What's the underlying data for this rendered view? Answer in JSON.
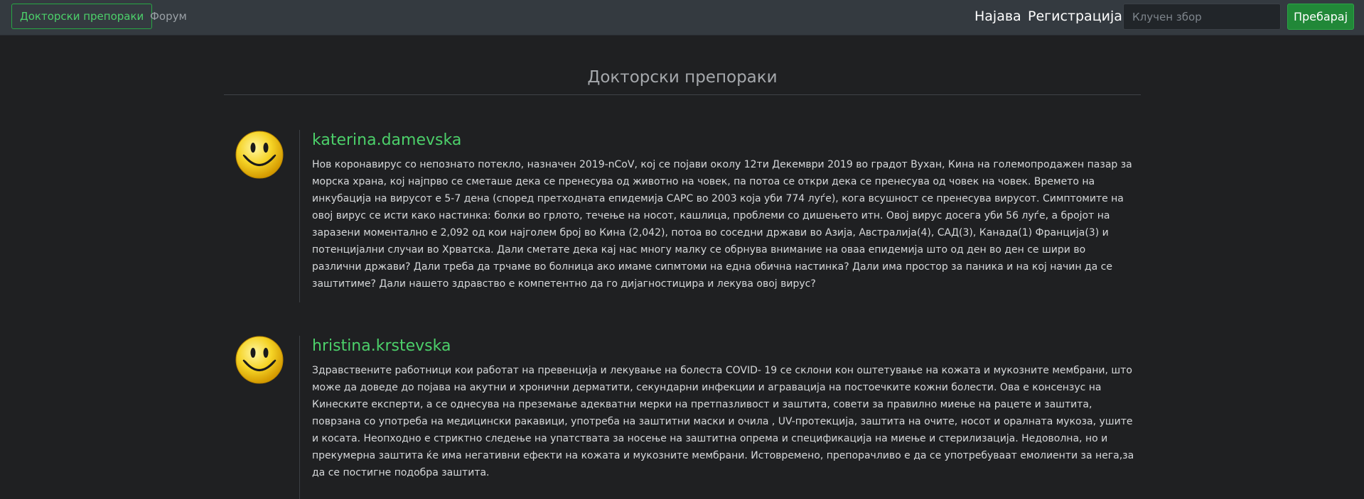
{
  "navbar": {
    "brand_label": "Докторски препораки",
    "forum_label": "Форум",
    "login_label": "Најава",
    "register_label": "Регистрација",
    "search_placeholder": "Клучен збор",
    "search_button_label": "Пребарај",
    "accent_color": "#28a745"
  },
  "main": {
    "title": "Докторски препораки",
    "posts": [
      {
        "avatar_icon": "smiley-face-icon",
        "username": "katerina.damevska",
        "text": "Нов коронавирус со непознато потекло, назначен 2019-nCoV, кој се појави околу 12ти Декември 2019 во градот Вухан, Кина на големопродажен пазар за морска храна, кој најпрво се сметаше дека се пренесува од животно на човек, па потоа се откри дека се пренесува од човек на човек. Времето на инкубација на вирусот е 5-7 дена (според претходната епидемија САРС во 2003 која уби 774 луѓе), кога всушност се пренесува вирусот. Симптомите на овој вирус се исти како настинка: болки во грлото, течење на носот, кашлица, проблеми со дишењето итн. Овој вирус досега уби 56 луѓе, а бројот на заразени моментално е 2,092 од кои најголем број во Кина (2,042), потоа во соседни држави во Азија, Австралија(4), САД(3), Канада(1) Франција(3) и потенцијални случаи во Хрватска. Дали сметате дека кај нас многу малку се обрнува внимание на оваа епидемија што од ден во ден се шири во различни држави? Дали треба да трчаме во болница ако имаме сипмтоми на една обична настинка? Дали има простор за паника и на кој начин да се заштитиме? Дали нашето здравство е компетентно да го дијагностицира и лекува овој вирус?"
      },
      {
        "avatar_icon": "smiley-face-icon",
        "username": "hristina.krstevska",
        "text": "Здравствените работници кои работат на превенција и лекување на болеста COVID- 19 се склони кон оштетување на кожата и мукозните мембрани, што може да доведе до појава на акутни и хронични дерматити, секундарни инфекции и агравација на постоечките кожни болести. Ова е консензус на Кинеските експерти, а се однесува на преземање адекватни мерки на претпазливост и заштита, совети за правилно миење на рацете и заштита, поврзана со употреба на медицински ракавици, употреба на заштитни маски и очила , UV-протекција, заштита на очите, носот и оралната мукоза, ушите и косата. Неопходно е стриктно следење на упатствата за носење на заштитна опрема и спецификација на миење и стерилизација. Недоволна, но и прекумерна заштита ќе има негативни ефекти на кожата и мукозните мембрани. Истовремено, препорачливо е да се употребуваат емолиенти за нега,за да се постигне подобра заштита."
      }
    ]
  }
}
